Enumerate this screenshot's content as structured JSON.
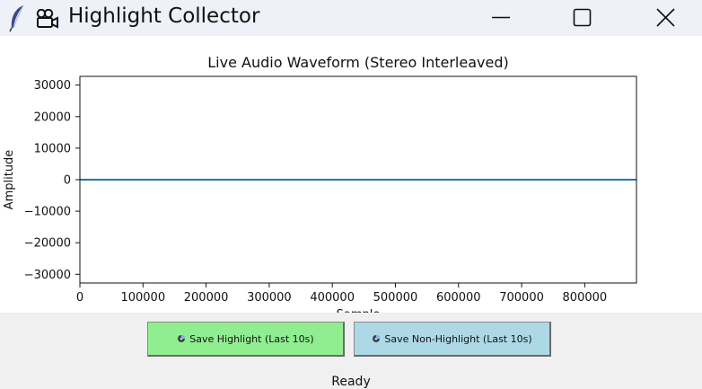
{
  "window": {
    "title": "Highlight Collector",
    "app_icon": "feather-icon",
    "title_icon": "movie-camera-icon",
    "controls": [
      "minimize-icon",
      "maximize-icon",
      "close-icon"
    ]
  },
  "buttons": {
    "save_highlight": "Save Highlight (Last 10s)",
    "save_non_highlight": "Save Non-Highlight (Last 10s)",
    "button_icon": "disk-icon",
    "highlight_color": "#90ee90",
    "non_highlight_color": "#add8e6"
  },
  "status": {
    "text": "Ready"
  },
  "chart_data": {
    "type": "line",
    "title": "Live Audio Waveform (Stereo Interleaved)",
    "xlabel": "Sample",
    "ylabel": "Amplitude",
    "xlim": [
      0,
      882000
    ],
    "ylim": [
      -32768,
      32767
    ],
    "x_ticks": [
      0,
      100000,
      200000,
      300000,
      400000,
      500000,
      600000,
      700000,
      800000
    ],
    "y_ticks": [
      30000,
      20000,
      10000,
      0,
      -10000,
      -20000,
      -30000
    ],
    "series": [
      {
        "x": [
          0,
          882000
        ],
        "values": [
          0,
          0
        ],
        "color": "#1f77b4"
      }
    ],
    "grid": false
  }
}
